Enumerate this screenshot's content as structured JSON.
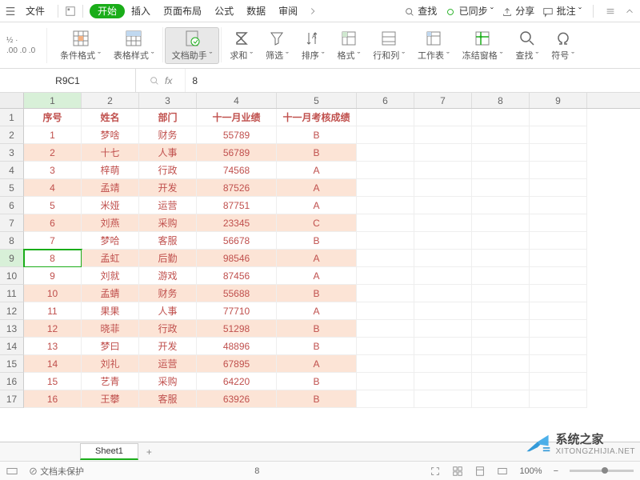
{
  "menu": {
    "file": "文件",
    "tabs": [
      "开始",
      "插入",
      "页面布局",
      "公式",
      "数据",
      "审阅"
    ],
    "active_tab": 0,
    "search": "查找",
    "synced": "已同步",
    "share": "分享",
    "annotate": "批注"
  },
  "ribbon": {
    "small_fmt": [
      "½",
      "000",
      "000",
      "000"
    ],
    "items": [
      {
        "label": "条件格式",
        "icon": "grid-cond"
      },
      {
        "label": "表格样式",
        "icon": "grid-style"
      },
      {
        "label": "文档助手",
        "icon": "doc-assist",
        "active": true
      },
      {
        "label": "求和",
        "icon": "sigma"
      },
      {
        "label": "筛选",
        "icon": "funnel"
      },
      {
        "label": "排序",
        "icon": "sort"
      },
      {
        "label": "格式",
        "icon": "cell-fmt"
      },
      {
        "label": "行和列",
        "icon": "rows-cols"
      },
      {
        "label": "工作表",
        "icon": "worksheet"
      },
      {
        "label": "冻结窗格",
        "icon": "freeze"
      },
      {
        "label": "查找",
        "icon": "search"
      },
      {
        "label": "符号",
        "icon": "omega"
      }
    ]
  },
  "formula_bar": {
    "name": "R9C1",
    "value": "8"
  },
  "grid": {
    "col_headers": [
      "1",
      "2",
      "3",
      "4",
      "5",
      "6",
      "7",
      "8",
      "9"
    ],
    "selected_col": 0,
    "selected_row": 9,
    "header_row": [
      "序号",
      "姓名",
      "部门",
      "十一月业绩",
      "十一月考核成绩"
    ],
    "rows": [
      [
        "1",
        "梦啥",
        "财务",
        "55789",
        "B"
      ],
      [
        "2",
        "十七",
        "人事",
        "56789",
        "B"
      ],
      [
        "3",
        "梓萌",
        "行政",
        "74568",
        "A"
      ],
      [
        "4",
        "孟靖",
        "开发",
        "87526",
        "A"
      ],
      [
        "5",
        "米娅",
        "运营",
        "87751",
        "A"
      ],
      [
        "6",
        "刘燕",
        "采购",
        "23345",
        "C"
      ],
      [
        "7",
        "梦哈",
        "客服",
        "56678",
        "B"
      ],
      [
        "8",
        "孟虹",
        "后勤",
        "98546",
        "A"
      ],
      [
        "9",
        "刘就",
        "游戏",
        "87456",
        "A"
      ],
      [
        "10",
        "孟蜻",
        "财务",
        "55688",
        "B"
      ],
      [
        "11",
        "果果",
        "人事",
        "77710",
        "A"
      ],
      [
        "12",
        "晓菲",
        "行政",
        "51298",
        "B"
      ],
      [
        "13",
        "梦曰",
        "开发",
        "48896",
        "B"
      ],
      [
        "14",
        "刘礼",
        "运营",
        "67895",
        "A"
      ],
      [
        "15",
        "艺青",
        "采购",
        "64220",
        "B"
      ],
      [
        "16",
        "王攀",
        "客服",
        "63926",
        "B"
      ]
    ],
    "data_cols": 5,
    "total_cols": 9
  },
  "sheets": {
    "active": "Sheet1"
  },
  "status": {
    "protect": "文档未保护",
    "center": "8",
    "zoom": "100%"
  },
  "watermark": {
    "title": "系统之家",
    "sub": "XITONGZHIJIA.NET"
  }
}
